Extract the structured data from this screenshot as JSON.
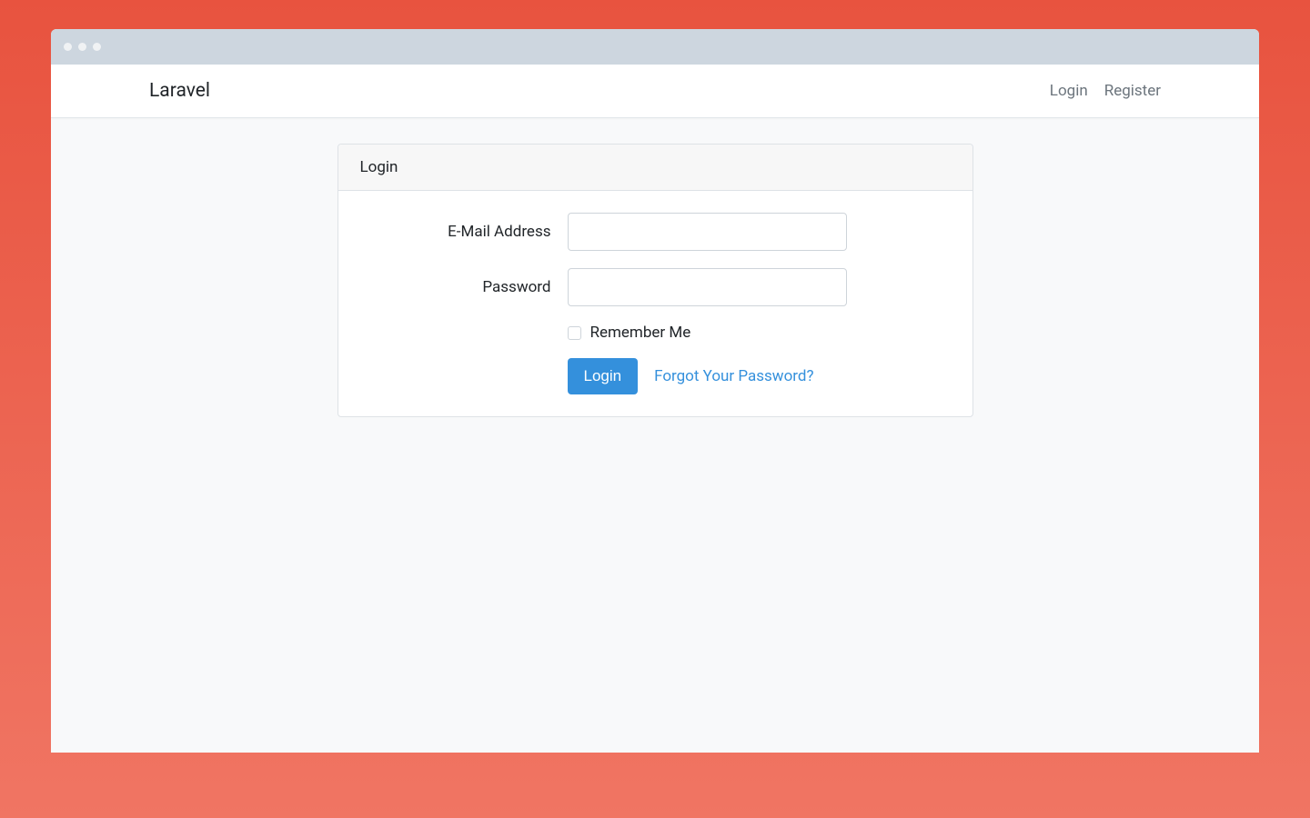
{
  "navbar": {
    "brand": "Laravel",
    "links": {
      "login": "Login",
      "register": "Register"
    }
  },
  "card": {
    "header": "Login"
  },
  "form": {
    "email_label": "E-Mail Address",
    "email_value": "",
    "password_label": "Password",
    "password_value": "",
    "remember_label": "Remember Me",
    "submit_label": "Login",
    "forgot_label": "Forgot Your Password?"
  }
}
